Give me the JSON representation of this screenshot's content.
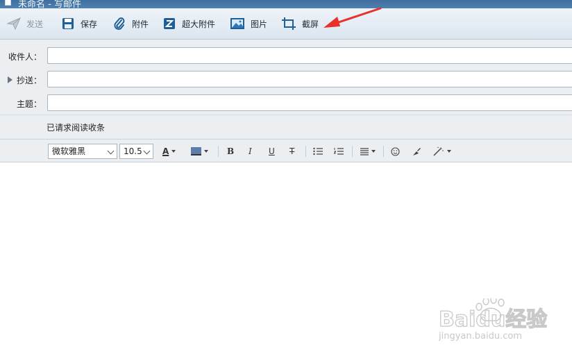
{
  "window": {
    "title": "未命名 - 写邮件"
  },
  "toolbar": {
    "send": {
      "label": "发送",
      "icon": "paper-plane-icon"
    },
    "save": {
      "label": "保存",
      "icon": "floppy-disk-icon"
    },
    "attach": {
      "label": "附件",
      "icon": "paperclip-icon"
    },
    "big_attach": {
      "label": "超大附件",
      "icon": "z-box-icon"
    },
    "picture": {
      "label": "图片",
      "icon": "picture-icon"
    },
    "screenshot": {
      "label": "截屏",
      "icon": "crop-icon"
    }
  },
  "fields": {
    "to_label": "收件人：",
    "cc_label": "抄送：",
    "subject_label": "主题：",
    "to_value": "",
    "cc_value": "",
    "subject_value": ""
  },
  "read_receipt": "已请求阅读收条",
  "format": {
    "font": "微软雅黑",
    "size": "10.5",
    "bold": "B",
    "italic": "I",
    "underline": "U",
    "strike": "T"
  },
  "body": {
    "content": ""
  },
  "watermark": {
    "brand": "Baidu经验",
    "url": "jingyan.baidu.com"
  },
  "colors": {
    "annotation_arrow": "#e8312a",
    "toolbar_icon": "#1d5f96"
  }
}
